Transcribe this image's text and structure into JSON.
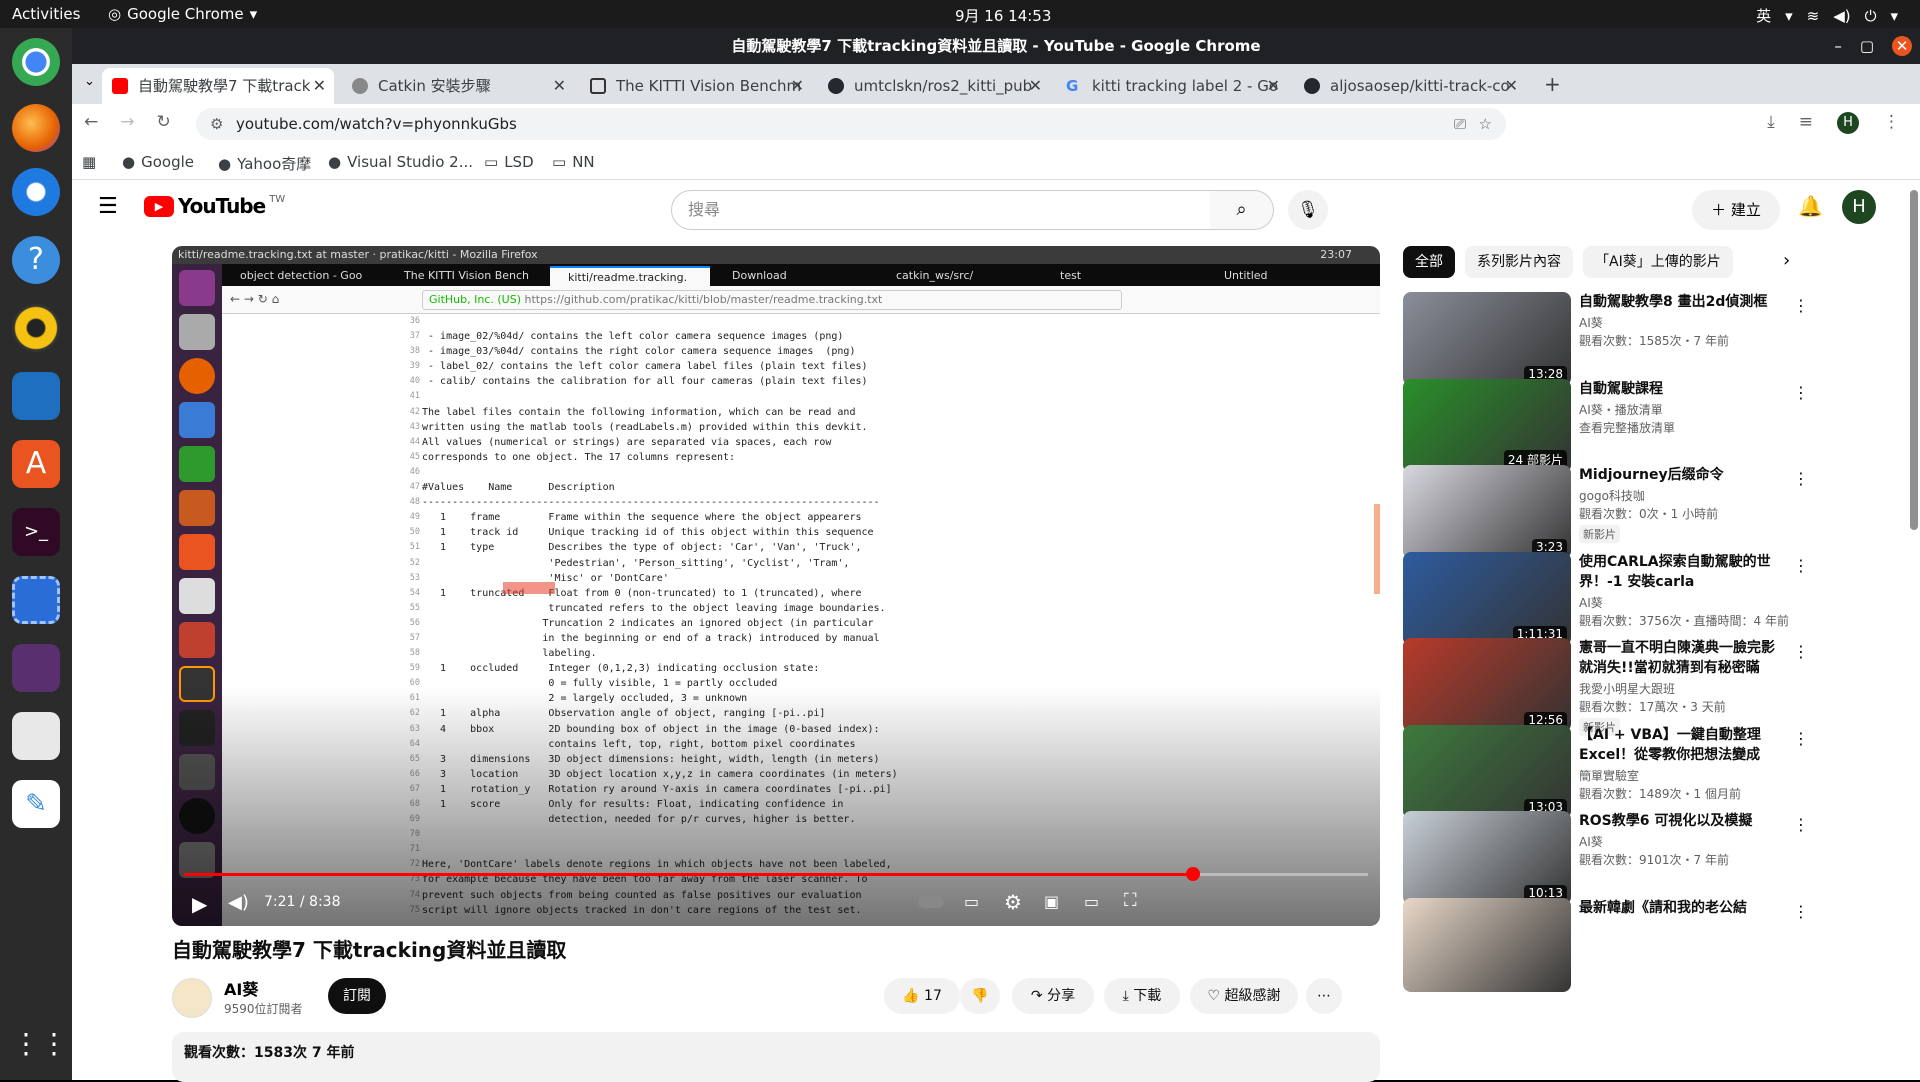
{
  "topbar": {
    "activities": "Activities",
    "app": "Google Chrome",
    "clock": "9月 16  14:53",
    "ime": "英"
  },
  "window": {
    "title": "自動駕駛教學7 下載tracking資料並且讀取 - YouTube - Google Chrome"
  },
  "tabs": [
    {
      "label": "自動駕駛教學7 下載track",
      "color": "#ff0000"
    },
    {
      "label": "Catkin 安裝步驟",
      "color": "#5f6368"
    },
    {
      "label": "The KITTI Vision Benchm",
      "color": "#5f6368"
    },
    {
      "label": "umtclskn/ros2_kitti_pub",
      "color": "#24292f"
    },
    {
      "label": "kitti tracking label 2 - Go",
      "color": "#4285f4"
    },
    {
      "label": "aljosaosep/kitti-track-co",
      "color": "#24292f"
    }
  ],
  "address": {
    "url": "youtube.com/watch?v=phyonnkuGbs"
  },
  "bookmarks": [
    "Google",
    "Yahoo奇摩",
    "Visual Studio 2...",
    "LSD",
    "NN"
  ],
  "youtube": {
    "logo_text": "YouTube",
    "region": "TW",
    "search_placeholder": "搜尋",
    "create_label": "建立",
    "avatar_letter": "H"
  },
  "video_frame": {
    "window_title": "kitti/readme.tracking.txt at master · pratikac/kitti - Mozilla Firefox",
    "time": "23:07",
    "tabs": [
      "object detection - Goo",
      "The KITTI Vision Bench",
      "kitti/readme.tracking.",
      "Download",
      "catkin_ws/src/",
      "test",
      "Untitled"
    ],
    "site": "GitHub, Inc. (US)",
    "url": "https://github.com/pratikac/kitti/blob/master/readme.tracking.txt",
    "line_numbers": "36\n37\n38\n39\n40\n41\n42\n43\n44\n45\n46\n47\n48\n49\n50\n51\n52\n53\n54\n55\n56\n57\n58\n59\n60\n61\n62\n63\n64\n65\n66\n67\n68\n69\n70\n71\n72\n73\n74\n75",
    "code": "\n - image_02/%04d/ contains the left color camera sequence images (png)\n - image_03/%04d/ contains the right color camera sequence images  (png)\n - label_02/ contains the left color camera label files (plain text files)\n - calib/ contains the calibration for all four cameras (plain text files)\n\nThe label files contain the following information, which can be read and\nwritten using the matlab tools (readLabels.m) provided within this devkit.\nAll values (numerical or strings) are separated via spaces, each row\ncorresponds to one object. The 17 columns represent:\n\n#Values    Name      Description\n----------------------------------------------------------------------------\n   1    frame        Frame within the sequence where the object appearers\n   1    track id     Unique tracking id of this object within this sequence\n   1    type         Describes the type of object: 'Car', 'Van', 'Truck',\n                     'Pedestrian', 'Person_sitting', 'Cyclist', 'Tram',\n                     'Misc' or 'DontCare'\n   1    truncated    Float from 0 (non-truncated) to 1 (truncated), where\n                     truncated refers to the object leaving image boundaries.\n                    Truncation 2 indicates an ignored object (in particular\n                    in the beginning or end of a track) introduced by manual\n                    labeling.\n   1    occluded     Integer (0,1,2,3) indicating occlusion state:\n                     0 = fully visible, 1 = partly occluded\n                     2 = largely occluded, 3 = unknown\n   1    alpha        Observation angle of object, ranging [-pi..pi]\n   4    bbox         2D bounding box of object in the image (0-based index):\n                     contains left, top, right, bottom pixel coordinates\n   3    dimensions   3D object dimensions: height, width, length (in meters)\n   3    location     3D object location x,y,z in camera coordinates (in meters)\n   1    rotation_y   Rotation ry around Y-axis in camera coordinates [-pi..pi]\n   1    score        Only for results: Float, indicating confidence in\n                     detection, needed for p/r curves, higher is better.\n\n\nHere, 'DontCare' labels denote regions in which objects have not been labeled,\nfor example because they have been too far away from the laser scanner. To\nprevent such objects from being counted as false positives our evaluation\nscript will ignore objects tracked in don't care regions of the test set."
  },
  "player": {
    "time": "7:21 / 8:38",
    "progress": 0.852
  },
  "video": {
    "title": "自動駕駛教學7 下載tracking資料並且讀取",
    "channel": "AI葵",
    "subscribers": "9590位訂閱者",
    "subscribe": "訂閱",
    "likes": "17",
    "share": "分享",
    "download": "下載",
    "thanks": "超級感謝",
    "views": "觀看次數：1583次  7 年前"
  },
  "chips": [
    "全部",
    "系列影片內容",
    "「AI葵」上傳的影片"
  ],
  "recommendations": [
    {
      "title": "自動駕駛教學8 畫出2d偵測框",
      "channel": "AI葵",
      "meta": "觀看次數：1585次・7 年前",
      "duration": "13:28",
      "badge": "",
      "color": "#8a8f9a"
    },
    {
      "title": "自動駕駛課程",
      "channel": "AI葵・播放清單",
      "meta": "查看完整播放清單",
      "duration": "24 部影片",
      "badge": "",
      "color": "#2a8f2a"
    },
    {
      "title": "Midjourney后缀命令",
      "channel": "gogo科技咖",
      "meta": "觀看次數：0次・1 小時前",
      "duration": "3:23",
      "badge": "新影片",
      "color": "#d8d8e0"
    },
    {
      "title": "使用CARLA探索自動駕駛的世界！-1 安裝carla",
      "channel": "AI葵",
      "meta": "觀看次數：3756次・直播時間：4 年前",
      "duration": "1:11:31",
      "badge": "",
      "color": "#2d5c9e"
    },
    {
      "title": "憲哥一直不明白陳漢典一臉完影就消失!!當初就猜到有秘密瞞著...",
      "channel": "我愛小明星大跟班",
      "meta": "觀看次數：17萬次・3 天前",
      "duration": "12:56",
      "badge": "新影片",
      "color": "#b83a2a"
    },
    {
      "title": "【AI + VBA】一鍵自動整理Excel！從零教你把想法變成自...",
      "channel": "簡單實驗室",
      "meta": "觀看次數：1489次・1 個月前",
      "duration": "13:03",
      "badge": "",
      "color": "#3d7a3d"
    },
    {
      "title": "ROS教學6 可視化以及模擬",
      "channel": "AI葵",
      "meta": "觀看次數：9101次・7 年前",
      "duration": "10:13",
      "badge": "",
      "color": "#c8d0d8"
    },
    {
      "title": "最新韓劇《請和我的老公結",
      "channel": "",
      "meta": "",
      "duration": "",
      "badge": "",
      "color": "#e8d8c8"
    }
  ]
}
